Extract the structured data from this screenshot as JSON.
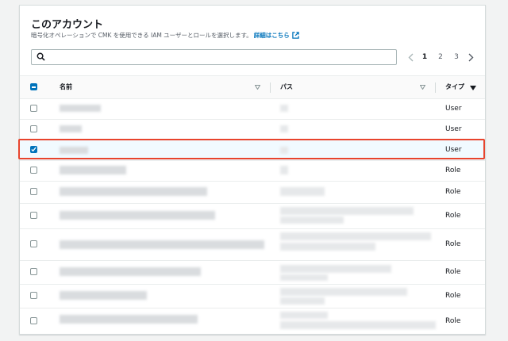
{
  "header": {
    "title": "このアカウント",
    "description": "暗号化オペレーションで CMK を使用できる IAM ユーザーとロールを選択します。",
    "link": "詳細はこちら"
  },
  "search": {
    "placeholder": ""
  },
  "pagination": {
    "pages": [
      "1",
      "2",
      "3"
    ],
    "current": "1"
  },
  "table": {
    "columns": {
      "name": "名前",
      "path": "パス",
      "type": "タイプ"
    },
    "rows": [
      {
        "type": "User",
        "selected": false
      },
      {
        "type": "User",
        "selected": false
      },
      {
        "type": "User",
        "selected": true
      },
      {
        "type": "Role",
        "selected": false
      },
      {
        "type": "Role",
        "selected": false
      },
      {
        "type": "Role",
        "selected": false
      },
      {
        "type": "Role",
        "selected": false
      },
      {
        "type": "Role",
        "selected": false
      },
      {
        "type": "Role",
        "selected": false
      },
      {
        "type": "Role",
        "selected": false
      }
    ]
  },
  "colors": {
    "accent": "#0073bb",
    "highlight": "#e8442d",
    "selected_row": "#f1faff"
  },
  "icons": [
    "search-icon",
    "external-link-icon",
    "chevron-left-icon",
    "chevron-right-icon",
    "sort-icon",
    "sort-desc-icon"
  ]
}
